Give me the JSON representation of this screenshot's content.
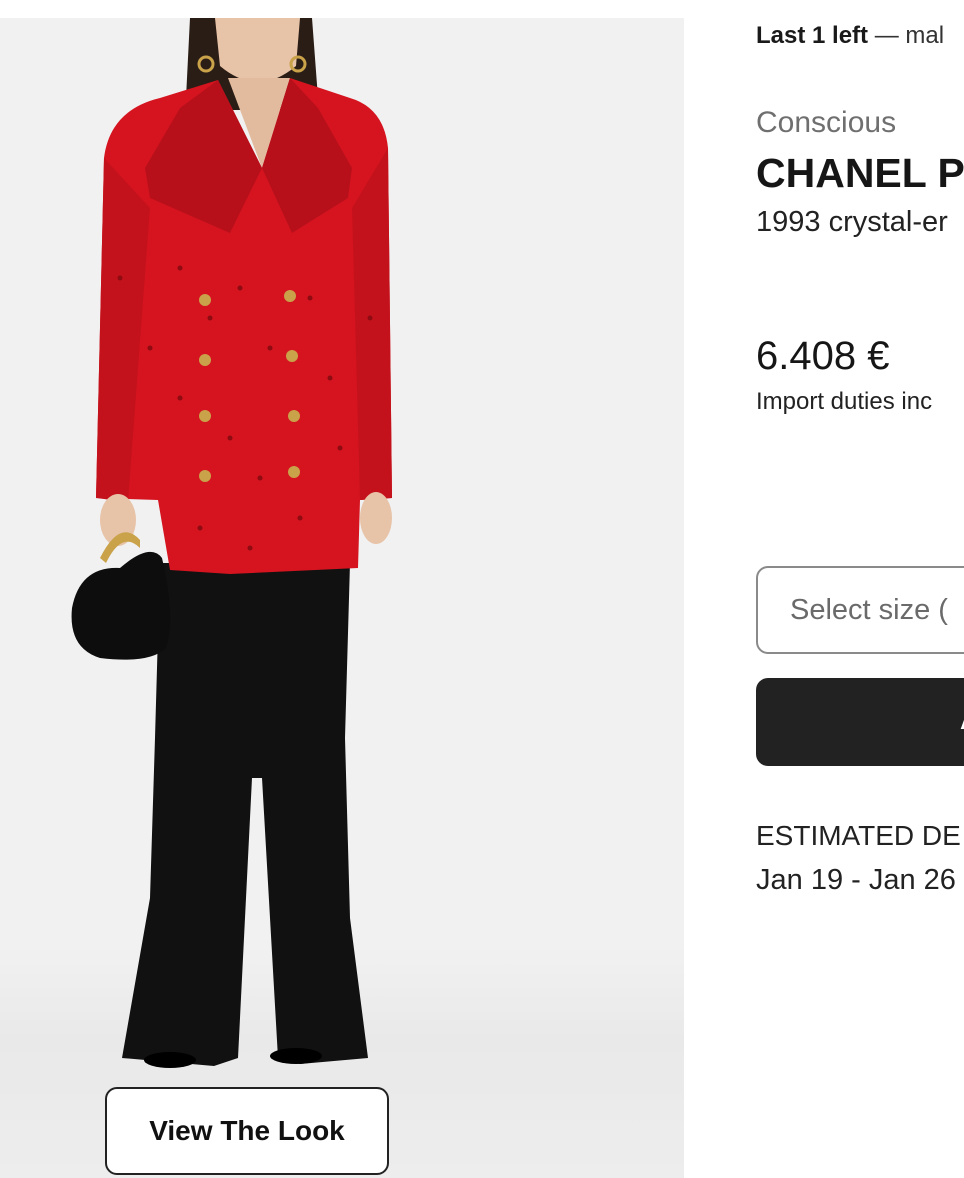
{
  "stock": {
    "strong": "Last 1 left",
    "note": "— mal"
  },
  "product": {
    "category": "Conscious",
    "brand": "CHANEL P",
    "description": "1993 crystal-er",
    "price": "6.408 €",
    "duties": "Import duties inc"
  },
  "size_select": {
    "placeholder": "Select size ("
  },
  "add_button": {
    "label": "A"
  },
  "delivery": {
    "label": "ESTIMATED DE",
    "dates": "Jan 19 - Jan 26"
  },
  "gallery": {
    "view_look_label": "View The Look"
  },
  "colors": {
    "jacket_red": "#d5141f",
    "button_gold": "#c9a24a",
    "trousers_black": "#111111",
    "primary_button": "#222222",
    "background_panel": "#f1f1f1"
  }
}
